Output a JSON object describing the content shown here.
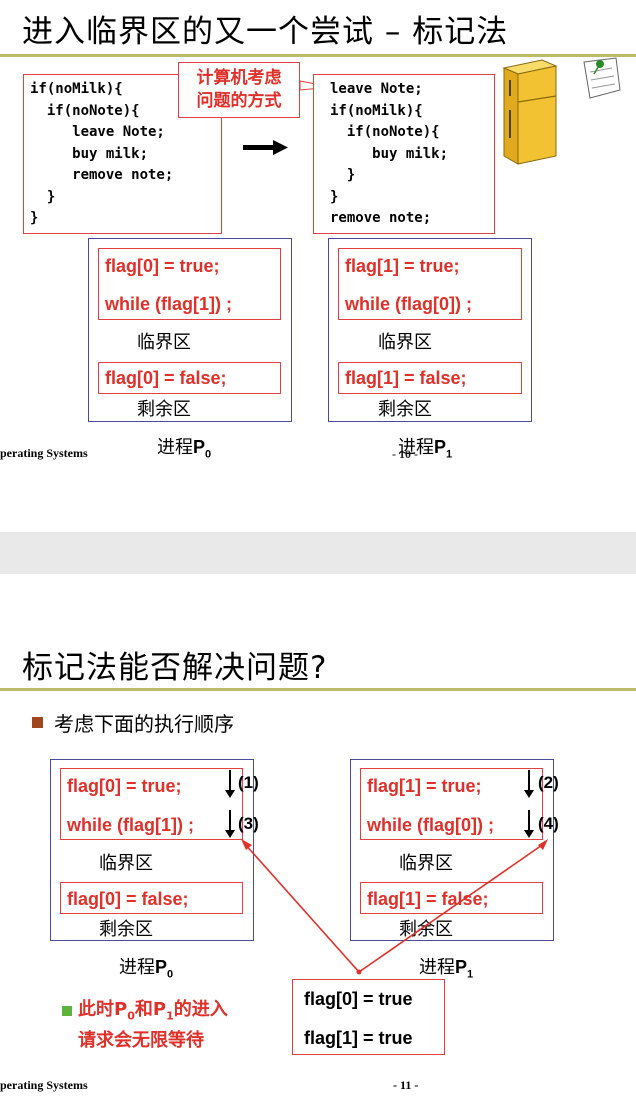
{
  "slide1": {
    "title": "进入临界区的又一个尝试 – 标记法",
    "code_left": "if(noMilk){\n  if(noNote){\n     leave Note;\n     buy milk;\n     remove note;\n  }\n}",
    "code_right": "leave Note;\nif(noMilk){\n  if(noNote){\n     buy milk;\n  }\n}\nremove note;",
    "tip_line1": "计算机考虑",
    "tip_line2": "问题的方式",
    "icons": [
      "right-arrow-icon",
      "refrigerator-with-note-icon"
    ],
    "p0": {
      "line1": "flag[0] = true;",
      "line2": "while (flag[1]) ;",
      "critical": "临界区",
      "line3": "flag[0] = false;",
      "remainder": "剩余区",
      "label": "进程",
      "label_p": "P",
      "label_sub": "0"
    },
    "p1": {
      "line1": "flag[1] = true;",
      "line2": "while (flag[0]) ;",
      "critical": "临界区",
      "line3": "flag[1] = false;",
      "remainder": "剩余区",
      "label": "进程",
      "label_p": "P",
      "label_sub": "1"
    },
    "footer_left": "perating Systems",
    "footer_page": "- 10 -"
  },
  "slide2": {
    "title": "标记法能否解决问题?",
    "bullet": "考虑下面的执行顺序",
    "p0": {
      "line1": "flag[0] = true;",
      "line2": "while (flag[1]) ;",
      "critical": "临界区",
      "line3": "flag[0] = false;",
      "remainder": "剩余区",
      "label": "进程",
      "label_p": "P",
      "label_sub": "0",
      "step1": "(1)",
      "step2": "(3)"
    },
    "p1": {
      "line1": "flag[1] = true;",
      "line2": "while (flag[0]) ;",
      "critical": "临界区",
      "line3": "flag[1] = false;",
      "remainder": "剩余区",
      "label": "进程",
      "label_p": "P",
      "label_sub": "1",
      "step1": "(2)",
      "step2": "(4)"
    },
    "state_line1": "flag[0] = true",
    "state_line2": "flag[1] = true",
    "note_a": "此时",
    "note_p0": "P",
    "note_sub0": "0",
    "note_and": "和",
    "note_p1": "P",
    "note_sub1": "1",
    "note_b": "的进入",
    "note_line2": "请求会无限等待",
    "footer_left": "perating Systems",
    "footer_page": "- 11 -"
  },
  "colors": {
    "accent_red": "#e0302a",
    "rule_olive": "#bcbc6a",
    "process_border": "#4a4a9a",
    "bullet1": "#a0451e",
    "bullet2": "#5ab53a"
  }
}
